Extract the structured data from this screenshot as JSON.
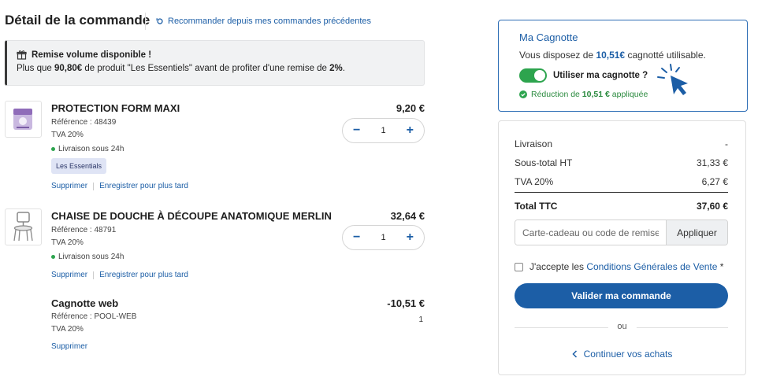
{
  "header": {
    "title": "Détail de la commande",
    "reorder_label": "Recommander depuis mes commandes précédentes"
  },
  "promo": {
    "title": "Remise volume disponible !",
    "text_prefix": "Plus que ",
    "amount": "90,80€",
    "text_middle": " de produit \"Les Essentiels\" avant de profiter d'une remise de ",
    "percent": "2%",
    "text_suffix": "."
  },
  "items": [
    {
      "name": "PROTECTION FORM MAXI",
      "price": "9,20 €",
      "reference": "Référence : 48439",
      "tva": "TVA 20%",
      "stock": "Livraison sous 24h",
      "badge": "Les Essentials",
      "quantity": "1",
      "remove": "Supprimer",
      "save": "Enregistrer pour plus tard"
    },
    {
      "name": "CHAISE DE DOUCHE À DÉCOUPE ANATOMIQUE MERLIN",
      "price": "32,64 €",
      "reference": "Référence : 48791",
      "tva": "TVA 20%",
      "stock": "Livraison sous 24h",
      "quantity": "1",
      "remove": "Supprimer",
      "save": "Enregistrer pour plus tard"
    },
    {
      "name": "Cagnotte web",
      "price": "-10,51 €",
      "reference": "Référence : POOL-WEB",
      "tva": "TVA 20%",
      "quantity": "1",
      "remove": "Supprimer"
    }
  ],
  "wallet": {
    "title": "Ma Cagnotte",
    "available_prefix": "Vous disposez de ",
    "available_amount": "10,51€",
    "available_suffix": " cagnotté utilisable.",
    "toggle_label": "Utiliser ma cagnotte ?",
    "toggle_on": true,
    "reduction_prefix": "Réduction de ",
    "reduction_amount": "10,51 €",
    "reduction_suffix": " appliquée"
  },
  "summary": {
    "rows": [
      {
        "label": "Livraison",
        "value": "-"
      },
      {
        "label": "Sous-total HT",
        "value": "31,33 €"
      },
      {
        "label": "TVA 20%",
        "value": "6,27 €"
      }
    ],
    "total_label": "Total TTC",
    "total_value": "37,60 €",
    "coupon_placeholder": "Carte-cadeau ou code de remise",
    "apply_label": "Appliquer",
    "cgv_prefix": "J'accepte les ",
    "cgv_link": "Conditions Générales de Vente",
    "cgv_suffix": " *",
    "validate_label": "Valider ma commande",
    "or_label": "ou",
    "continue_label": "Continuer vos achats"
  },
  "colors": {
    "accent": "#1c5ea6",
    "success": "#2da44e",
    "badge_bg": "#dfe4f5"
  }
}
